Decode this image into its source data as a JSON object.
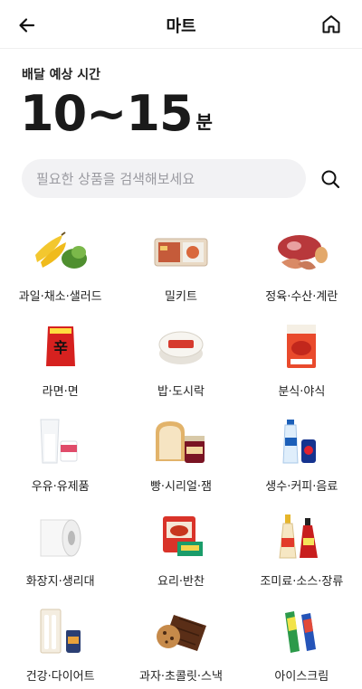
{
  "header": {
    "title": "마트",
    "back_icon": "arrow-left-icon",
    "home_icon": "home-icon"
  },
  "eta": {
    "label": "배달 예상 시간",
    "value": "10~15",
    "unit": "분"
  },
  "search": {
    "placeholder": "필요한 상품을 검색해보세요",
    "value": "",
    "icon": "search-icon"
  },
  "categories": [
    {
      "label": "과일·채소·샐러드",
      "icon": "fruit-vegetable-icon"
    },
    {
      "label": "밀키트",
      "icon": "mealkit-icon"
    },
    {
      "label": "정육·수산·계란",
      "icon": "meat-seafood-egg-icon"
    },
    {
      "label": "라면·면",
      "icon": "ramen-icon"
    },
    {
      "label": "밥·도시락",
      "icon": "rice-lunchbox-icon"
    },
    {
      "label": "분식·야식",
      "icon": "snack-food-icon"
    },
    {
      "label": "우유·유제품",
      "icon": "milk-dairy-icon"
    },
    {
      "label": "빵·시리얼·잼",
      "icon": "bread-cereal-jam-icon"
    },
    {
      "label": "생수·커피·음료",
      "icon": "water-coffee-drink-icon"
    },
    {
      "label": "화장지·생리대",
      "icon": "tissue-pad-icon"
    },
    {
      "label": "요리·반찬",
      "icon": "side-dish-icon"
    },
    {
      "label": "조미료·소스·장류",
      "icon": "seasoning-sauce-icon"
    },
    {
      "label": "건강·다이어트",
      "icon": "health-diet-icon"
    },
    {
      "label": "과자·초콜릿·스낵",
      "icon": "snack-chocolate-icon"
    },
    {
      "label": "아이스크림",
      "icon": "ice-cream-icon"
    }
  ]
}
